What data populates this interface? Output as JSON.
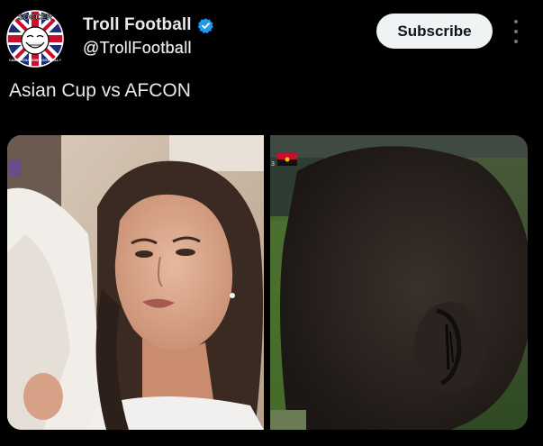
{
  "post": {
    "author": {
      "display_name": "Troll Football",
      "handle": "@TrollFootball",
      "verified": true,
      "avatar_text_top": "SOCCER",
      "avatar_text_bottom": "CAN'T YOU NOW FOOTBALL?"
    },
    "subscribe_label": "Subscribe",
    "more_icon": "more-vertical-icon",
    "text": "Asian Cup vs AFCON",
    "media": [
      {
        "name": "asian-cup-photo",
        "description_icon": "photo"
      },
      {
        "name": "afcon-photo",
        "description_icon": "photo"
      }
    ]
  },
  "colors": {
    "background": "#000000",
    "text": "#e7e9ea",
    "subscribe_bg": "#eff3f4",
    "subscribe_text": "#0f1419",
    "verified": "#1d9bf0",
    "muted": "#71767b"
  }
}
